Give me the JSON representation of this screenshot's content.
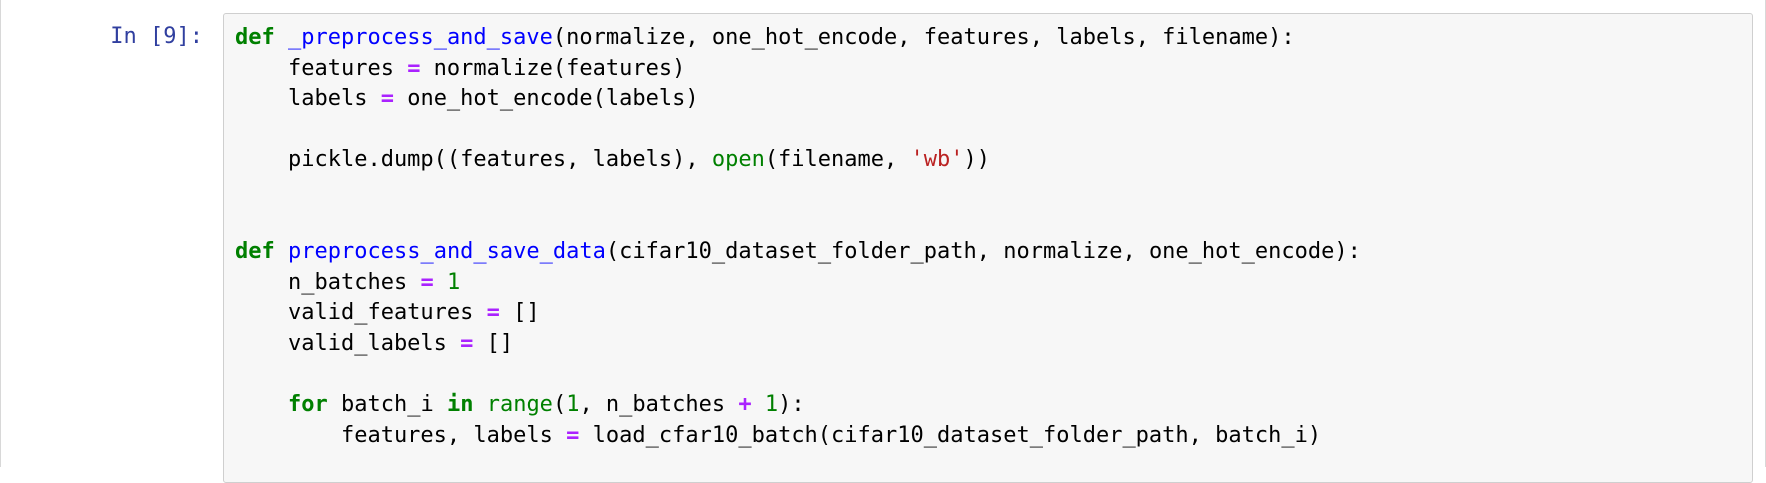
{
  "notebook": {
    "cell": {
      "prompt": "In [9]:",
      "lines": [
        [
          {
            "t": "def",
            "c": "kw"
          },
          {
            "t": " ",
            "c": ""
          },
          {
            "t": "_preprocess_and_save",
            "c": "fn"
          },
          {
            "t": "(normalize, one_hot_encode, features, labels, filename):",
            "c": ""
          }
        ],
        [
          {
            "t": "    features ",
            "c": ""
          },
          {
            "t": "=",
            "c": "op"
          },
          {
            "t": " normalize(features)",
            "c": ""
          }
        ],
        [
          {
            "t": "    labels ",
            "c": ""
          },
          {
            "t": "=",
            "c": "op"
          },
          {
            "t": " one_hot_encode(labels)",
            "c": ""
          }
        ],
        [],
        [
          {
            "t": "    pickle.dump((features, labels), ",
            "c": ""
          },
          {
            "t": "open",
            "c": "bi"
          },
          {
            "t": "(filename, ",
            "c": ""
          },
          {
            "t": "'wb'",
            "c": "str"
          },
          {
            "t": "))",
            "c": ""
          }
        ],
        [],
        [],
        [
          {
            "t": "def",
            "c": "kw"
          },
          {
            "t": " ",
            "c": ""
          },
          {
            "t": "preprocess_and_save_data",
            "c": "fn"
          },
          {
            "t": "(cifar10_dataset_folder_path, normalize, one_hot_encode):",
            "c": ""
          }
        ],
        [
          {
            "t": "    n_batches ",
            "c": ""
          },
          {
            "t": "=",
            "c": "op"
          },
          {
            "t": " ",
            "c": ""
          },
          {
            "t": "1",
            "c": "num"
          }
        ],
        [
          {
            "t": "    valid_features ",
            "c": ""
          },
          {
            "t": "=",
            "c": "op"
          },
          {
            "t": " []",
            "c": ""
          }
        ],
        [
          {
            "t": "    valid_labels ",
            "c": ""
          },
          {
            "t": "=",
            "c": "op"
          },
          {
            "t": " []",
            "c": ""
          }
        ],
        [],
        [
          {
            "t": "    ",
            "c": ""
          },
          {
            "t": "for",
            "c": "kw"
          },
          {
            "t": " batch_i ",
            "c": ""
          },
          {
            "t": "in",
            "c": "kw"
          },
          {
            "t": " ",
            "c": ""
          },
          {
            "t": "range",
            "c": "bi"
          },
          {
            "t": "(",
            "c": ""
          },
          {
            "t": "1",
            "c": "num"
          },
          {
            "t": ", n_batches ",
            "c": ""
          },
          {
            "t": "+",
            "c": "op"
          },
          {
            "t": " ",
            "c": ""
          },
          {
            "t": "1",
            "c": "num"
          },
          {
            "t": "):",
            "c": ""
          }
        ],
        [
          {
            "t": "        features, labels ",
            "c": ""
          },
          {
            "t": "=",
            "c": "op"
          },
          {
            "t": " load_cfar10_batch(cifar10_dataset_folder_path, batch_i)",
            "c": ""
          }
        ]
      ]
    }
  }
}
